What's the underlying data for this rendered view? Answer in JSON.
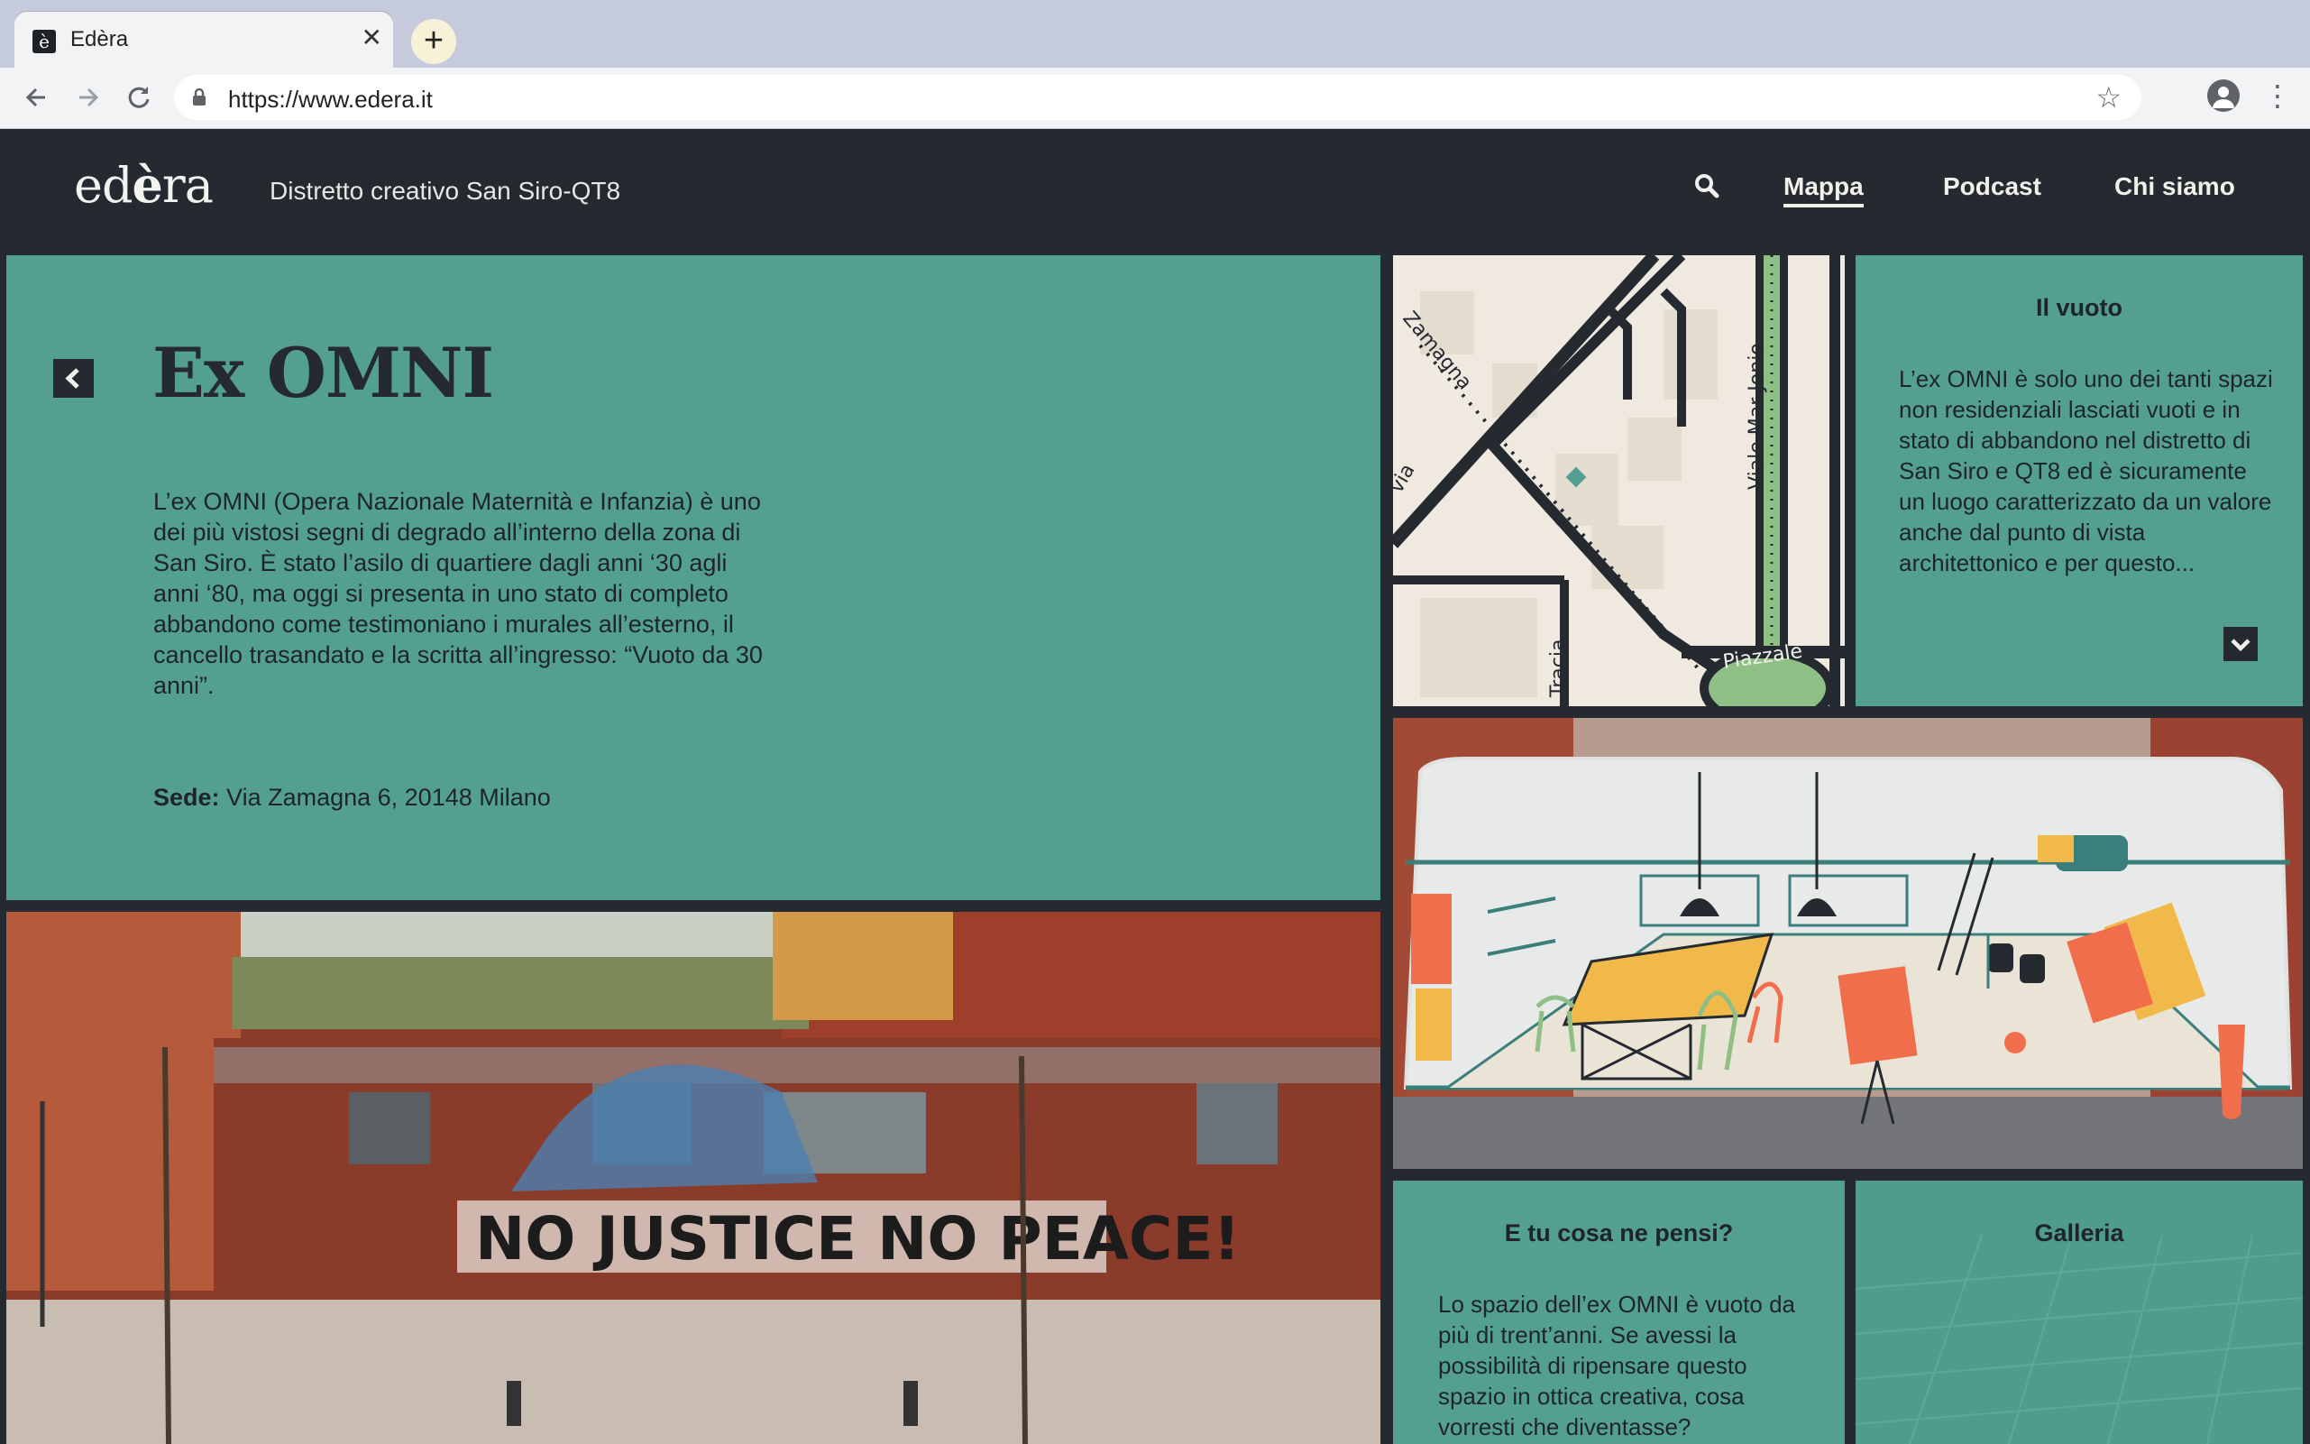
{
  "browser": {
    "tab_title": "Edèra",
    "tab_favicon": "è",
    "close_glyph": "✕",
    "newtab_glyph": "+",
    "url": "https://www.edera.it",
    "nav_icons": [
      "back-arrow-icon",
      "forward-arrow-icon",
      "reload-icon",
      "lock-icon",
      "star-icon",
      "profile-icon",
      "kebab-menu-icon"
    ]
  },
  "header": {
    "logo_prefix": "ed",
    "logo_accent": "è",
    "logo_suffix": "ra",
    "tagline": "Distretto creativo San Siro-QT8",
    "nav": {
      "mappa": "Mappa",
      "podcast": "Podcast",
      "chi_siamo": "Chi siamo"
    },
    "active_nav": "Mappa"
  },
  "main": {
    "title": "Ex OMNI",
    "description": "L’ex OMNI (Opera Nazionale Maternità e Infanzia) è uno dei più vistosi segni di degrado all’interno della zona di San Siro. È stato l’asilo di quartiere dagli anni ‘30 agli anni ‘80, ma oggi si presenta in uno stato di completo abbandono come testimoniano i murales all’esterno, il cancello trasandato e la scritta all’ingresso: “Vuoto da 30 anni”.",
    "sede_label": "Sede:",
    "sede_value": "Via Zamagna 6, 20148 Milano"
  },
  "map": {
    "labels": {
      "zamagna": "Zamagna",
      "via": "via",
      "viale": "Viale Mar Jonio",
      "tracia": "Tracia",
      "piazzale": "Piazzale"
    }
  },
  "photo": {
    "graffiti": "NO JUSTICE NO PEACE!"
  },
  "vuoto": {
    "title": "Il vuoto",
    "text": "L’ex OMNI è solo uno dei tanti spazi non residenziali lasciati vuoti e in stato di abbandono nel distretto di San Siro e QT8 ed è sicuramente un luogo caratterizzato da un valore anche dal punto di vista architettonico e per questo..."
  },
  "tu": {
    "title": "E tu cosa ne pensi?",
    "text": "Lo spazio dell’ex OMNI è vuoto da più di trent’anni. Se avessi la possibilità di ripensare questo spazio in ottica creativa, cosa vorresti che diventasse?"
  },
  "galleria": {
    "title": "Galleria"
  },
  "colors": {
    "teal": "#53a092",
    "dark": "#252a31",
    "cream": "#f1f1ec",
    "brick": "#8a3b2a"
  }
}
